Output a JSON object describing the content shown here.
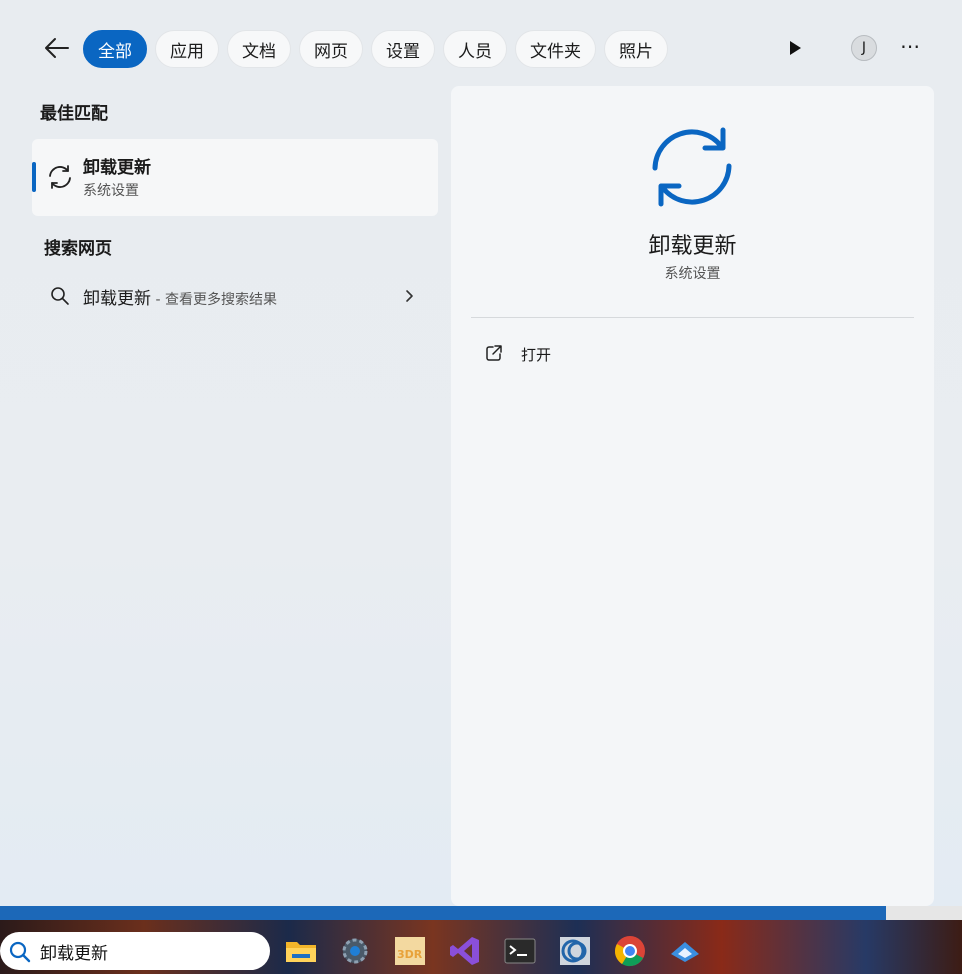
{
  "filters": [
    {
      "label": "全部",
      "active": true
    },
    {
      "label": "应用",
      "active": false
    },
    {
      "label": "文档",
      "active": false
    },
    {
      "label": "网页",
      "active": false
    },
    {
      "label": "设置",
      "active": false
    },
    {
      "label": "人员",
      "active": false
    },
    {
      "label": "文件夹",
      "active": false
    },
    {
      "label": "照片",
      "active": false
    }
  ],
  "avatar_initial": "J",
  "best_match": {
    "section": "最佳匹配",
    "title": "卸载更新",
    "subtitle": "系统设置"
  },
  "web_search": {
    "section": "搜索网页",
    "query": "卸载更新",
    "hint": " - 查看更多搜索结果"
  },
  "detail": {
    "title": "卸载更新",
    "subtitle": "系统设置",
    "action_open": "打开"
  },
  "taskbar": {
    "search_value": "卸载更新",
    "icons": [
      "file-explorer-icon",
      "settings-icon",
      "3dr-icon",
      "visual-studio-icon",
      "terminal-icon",
      "cc-app-icon",
      "chrome-icon",
      "vpn-app-icon"
    ]
  },
  "colors": {
    "accent": "#0a66c2"
  }
}
